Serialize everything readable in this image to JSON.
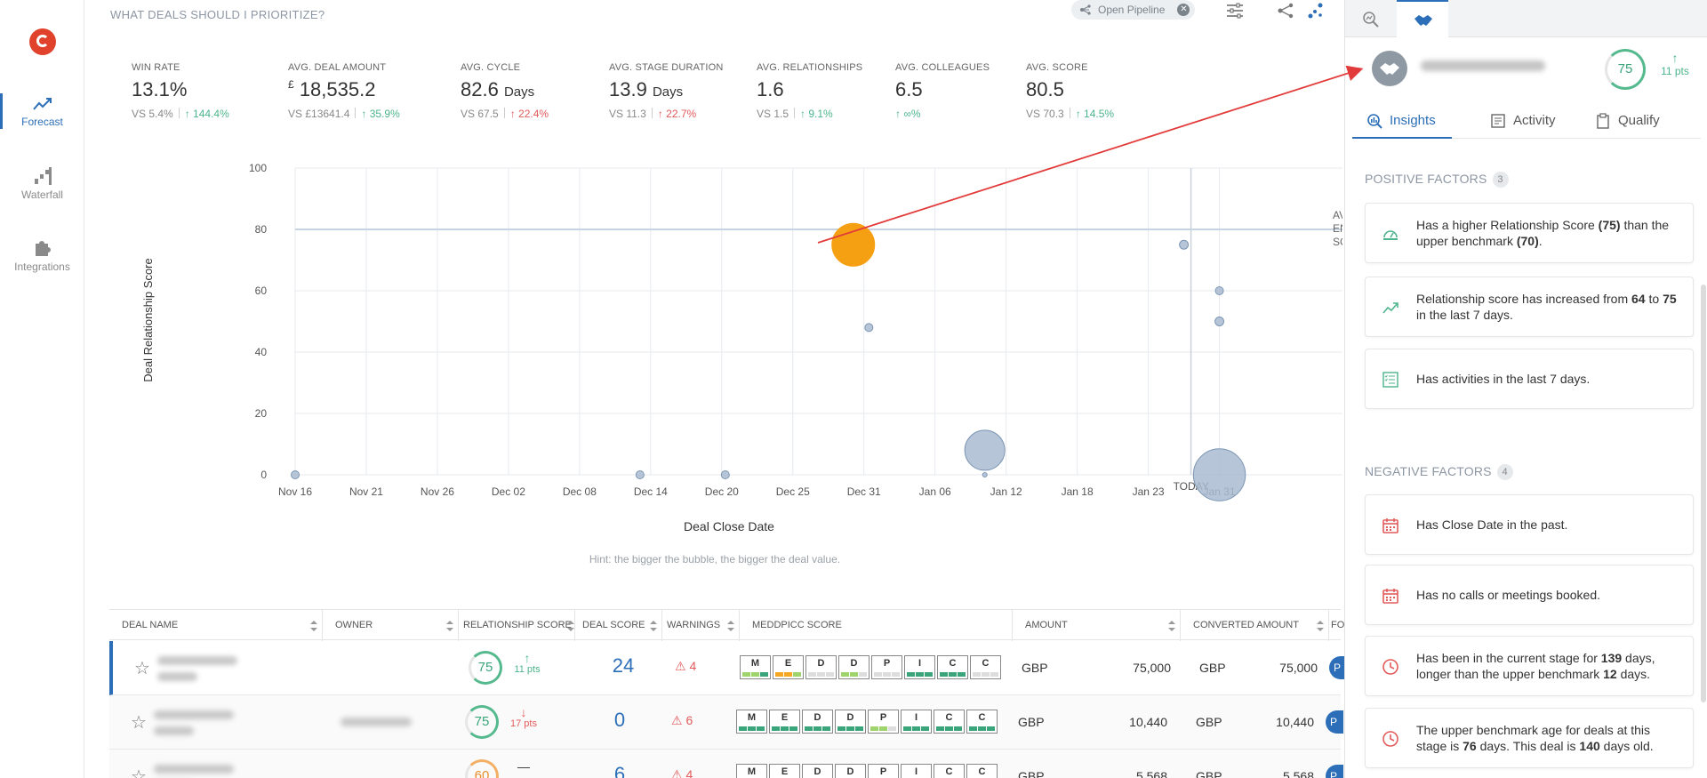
{
  "nav": {
    "items": [
      {
        "label": "Forecast",
        "icon": "trend-line-icon"
      },
      {
        "label": "Waterfall",
        "icon": "waterfall-icon"
      },
      {
        "label": "Integrations",
        "icon": "puzzle-icon"
      }
    ]
  },
  "header": {
    "title": "WHAT DEALS SHOULD I PRIORITIZE?",
    "pipeline_chip": "Open Pipeline"
  },
  "kpis": [
    {
      "label": "WIN RATE",
      "value": "13.1%",
      "vs": "VS  5.4%",
      "delta": "144.4%",
      "dir": "up"
    },
    {
      "label": "AVG. DEAL AMOUNT",
      "currency": "£",
      "value": "18,535.2",
      "vs": "VS  £13641.4",
      "delta": "35.9%",
      "dir": "up"
    },
    {
      "label": "AVG. CYCLE",
      "value": "82.6",
      "unit": "Days",
      "vs": "VS  67.5",
      "delta": "22.4%",
      "dir": "down"
    },
    {
      "label": "AVG. STAGE DURATION",
      "value": "13.9",
      "unit": "Days",
      "vs": "VS  11.3",
      "delta": "22.7%",
      "dir": "down"
    },
    {
      "label": "AVG. RELATIONSHIPS",
      "value": "1.6",
      "vs": "VS  1.5",
      "delta": "9.1%",
      "dir": "up"
    },
    {
      "label": "AVG. COLLEAGUES",
      "value": "6.5",
      "vs": "",
      "delta": "∞%",
      "dir": "up"
    },
    {
      "label": "AVG. SCORE",
      "value": "80.5",
      "vs": "VS  70.3",
      "delta": "14.5%",
      "dir": "up"
    }
  ],
  "chart_data": {
    "type": "scatter",
    "xlabel": "Deal Close Date",
    "ylabel": "Deal Relationship Score",
    "ylim": [
      0,
      100
    ],
    "y_ticks": [
      0,
      20,
      40,
      60,
      80,
      100
    ],
    "x_ticks": [
      "Nov 16",
      "Nov 21",
      "Nov 26",
      "Dec 02",
      "Dec 08",
      "Dec 14",
      "Dec 20",
      "Dec 25",
      "Dec 31",
      "Jan 06",
      "Jan 12",
      "Jan 18",
      "Jan 23",
      "Jan 31"
    ],
    "today_label": "TODAY",
    "today_index": 12.6,
    "reference_line": {
      "y": 80,
      "label": [
        "AVG.",
        "ENGAGEMENT",
        "SCORE"
      ]
    },
    "grid": true,
    "points": [
      {
        "x": 0,
        "y": 0,
        "size": 1,
        "highlight": false
      },
      {
        "x": 4.85,
        "y": 0,
        "size": 1,
        "highlight": false
      },
      {
        "x": 6.05,
        "y": 0,
        "size": 1,
        "highlight": false
      },
      {
        "x": 7.85,
        "y": 75,
        "size": 4,
        "highlight": true
      },
      {
        "x": 8.07,
        "y": 48,
        "size": 1,
        "highlight": false
      },
      {
        "x": 9.7,
        "y": 8,
        "size": 5,
        "highlight": false
      },
      {
        "x": 9.7,
        "y": 0,
        "size": 0.4,
        "highlight": false
      },
      {
        "x": 12.5,
        "y": 75,
        "size": 1.1,
        "highlight": false
      },
      {
        "x": 13.0,
        "y": 60,
        "size": 1,
        "highlight": false
      },
      {
        "x": 13.0,
        "y": 50,
        "size": 1.1,
        "highlight": false
      },
      {
        "x": 13.0,
        "y": 0,
        "size": 6.5,
        "highlight": false
      }
    ],
    "colors": {
      "bubble": "#a9bbd0",
      "bubble_stroke": "#7b95b3",
      "highlight": "#f5a012",
      "ref_line": "#c6d3e3"
    }
  },
  "hint": "Hint: the bigger the bubble, the bigger the deal value.",
  "table": {
    "columns": [
      "DEAL NAME",
      "OWNER",
      "RELATIONSHIP SCORE",
      "DEAL SCORE",
      "WARNINGS",
      "MEDDPICC SCORE",
      "AMOUNT",
      "CONVERTED AMOUNT",
      "FORE"
    ],
    "meddpicc_letters": [
      "M",
      "E",
      "D",
      "D",
      "P",
      "I",
      "C",
      "C"
    ],
    "rows": [
      {
        "rel_score": "75",
        "rel_delta": "11 pts",
        "rel_dir": "up",
        "deal_score": "24",
        "warnings": "4",
        "currency": "GBP",
        "amount": "75,000",
        "conv_currency": "GBP",
        "conv_amount": "75,000",
        "fore": "P",
        "meddpicc": [
          [
            "l",
            "l",
            "g"
          ],
          [
            "o",
            "o",
            "l"
          ],
          [
            "d",
            "d",
            "d"
          ],
          [
            "l",
            "l",
            "d"
          ],
          [
            "d",
            "d",
            "d"
          ],
          [
            "g",
            "g",
            "g"
          ],
          [
            "g",
            "g",
            "g"
          ],
          [
            "d",
            "d",
            "d"
          ]
        ]
      },
      {
        "rel_score": "75",
        "rel_delta": "17 pts",
        "rel_dir": "down",
        "deal_score": "0",
        "warnings": "6",
        "currency": "GBP",
        "amount": "10,440",
        "conv_currency": "GBP",
        "conv_amount": "10,440",
        "fore": "P",
        "meddpicc": [
          [
            "g",
            "g",
            "g"
          ],
          [
            "g",
            "g",
            "g"
          ],
          [
            "g",
            "g",
            "g"
          ],
          [
            "g",
            "g",
            "g"
          ],
          [
            "l",
            "l",
            "d"
          ],
          [
            "g",
            "g",
            "g"
          ],
          [
            "g",
            "g",
            "g"
          ],
          [
            "g",
            "g",
            "g"
          ]
        ]
      },
      {
        "rel_score": "60",
        "rel_delta": "",
        "rel_dir": "flat",
        "deal_score": "6",
        "warnings": "4",
        "currency": "GBP",
        "amount": "5,568",
        "conv_currency": "GBP",
        "conv_amount": "5,568",
        "fore": "P",
        "meddpicc": [
          [
            "d",
            "d",
            "d"
          ],
          [
            "d",
            "d",
            "d"
          ],
          [
            "d",
            "d",
            "d"
          ],
          [
            "d",
            "d",
            "d"
          ],
          [
            "d",
            "d",
            "d"
          ],
          [
            "d",
            "d",
            "d"
          ],
          [
            "d",
            "d",
            "d"
          ],
          [
            "d",
            "d",
            "d"
          ]
        ]
      }
    ]
  },
  "panel": {
    "score": "75",
    "score_delta": "11 pts",
    "tabs": [
      "Insights",
      "Activity",
      "Qualify"
    ],
    "positive": {
      "title": "POSITIVE FACTORS",
      "count": "3",
      "items": [
        {
          "icon": "gauge-icon",
          "parts": [
            "Has a higher Relationship Score ",
            "(75)",
            " than the upper benchmark ",
            "(70)",
            "."
          ]
        },
        {
          "icon": "trend-up-icon",
          "parts": [
            "Relationship score has increased from ",
            "64",
            " to ",
            "75",
            " in the last 7 days."
          ]
        },
        {
          "icon": "checklist-icon",
          "parts": [
            "Has activities in the last 7 days."
          ]
        }
      ]
    },
    "negative": {
      "title": "NEGATIVE FACTORS",
      "count": "4",
      "items": [
        {
          "icon": "calendar-icon",
          "parts": [
            "Has Close Date in the past."
          ]
        },
        {
          "icon": "calendar-icon",
          "parts": [
            "Has no calls or meetings booked."
          ]
        },
        {
          "icon": "clock-icon",
          "parts": [
            "Has been in the current stage for ",
            "139",
            " days, longer than the upper benchmark ",
            "12",
            " days."
          ]
        },
        {
          "icon": "clock-icon",
          "parts": [
            "The upper benchmark age for deals at this stage is ",
            "76",
            " days. This deal is ",
            "140",
            " days old."
          ]
        }
      ]
    }
  }
}
